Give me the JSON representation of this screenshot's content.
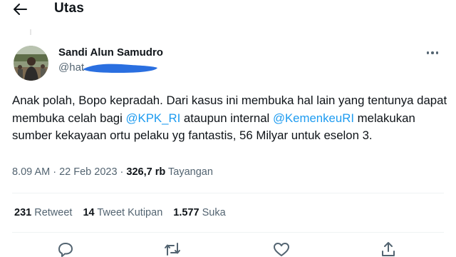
{
  "header": {
    "title": "Utas",
    "back_icon": "arrow-left-icon"
  },
  "tweet": {
    "author": {
      "name": "Sandi Alun Samudro",
      "handle_visible": "@hat",
      "avatar_icon": "profile-photo"
    },
    "more_icon": "more-horizontal-icon",
    "text_segments": [
      "Anak polah, Bopo kepradah. Dari kasus ini membuka hal lain yang tentunya dapat membuka celah bagi ",
      "@KPK_RI",
      " ataupun internal ",
      "@KemenkeuRI",
      " melakukan sumber kekayaan ortu pelaku yg fantastis, 56 Milyar untuk eselon 3."
    ],
    "meta": {
      "time": "8.09 AM",
      "separator": " · ",
      "date": "22 Feb 2023",
      "views_count": "326,7 rb",
      "views_label": "Tayangan"
    },
    "stats": {
      "retweets_count": "231",
      "retweets_label": "Retweet",
      "quotes_count": "14",
      "quotes_label": "Tweet Kutipan",
      "likes_count": "1.577",
      "likes_label": "Suka"
    },
    "actions": [
      "reply-icon",
      "retweet-icon",
      "like-icon",
      "share-icon"
    ]
  },
  "colors": {
    "text": "#0f1419",
    "secondary": "#536471",
    "link": "#1d9bf0",
    "redaction": "#2a6fe0",
    "divider": "#eff3f4"
  }
}
